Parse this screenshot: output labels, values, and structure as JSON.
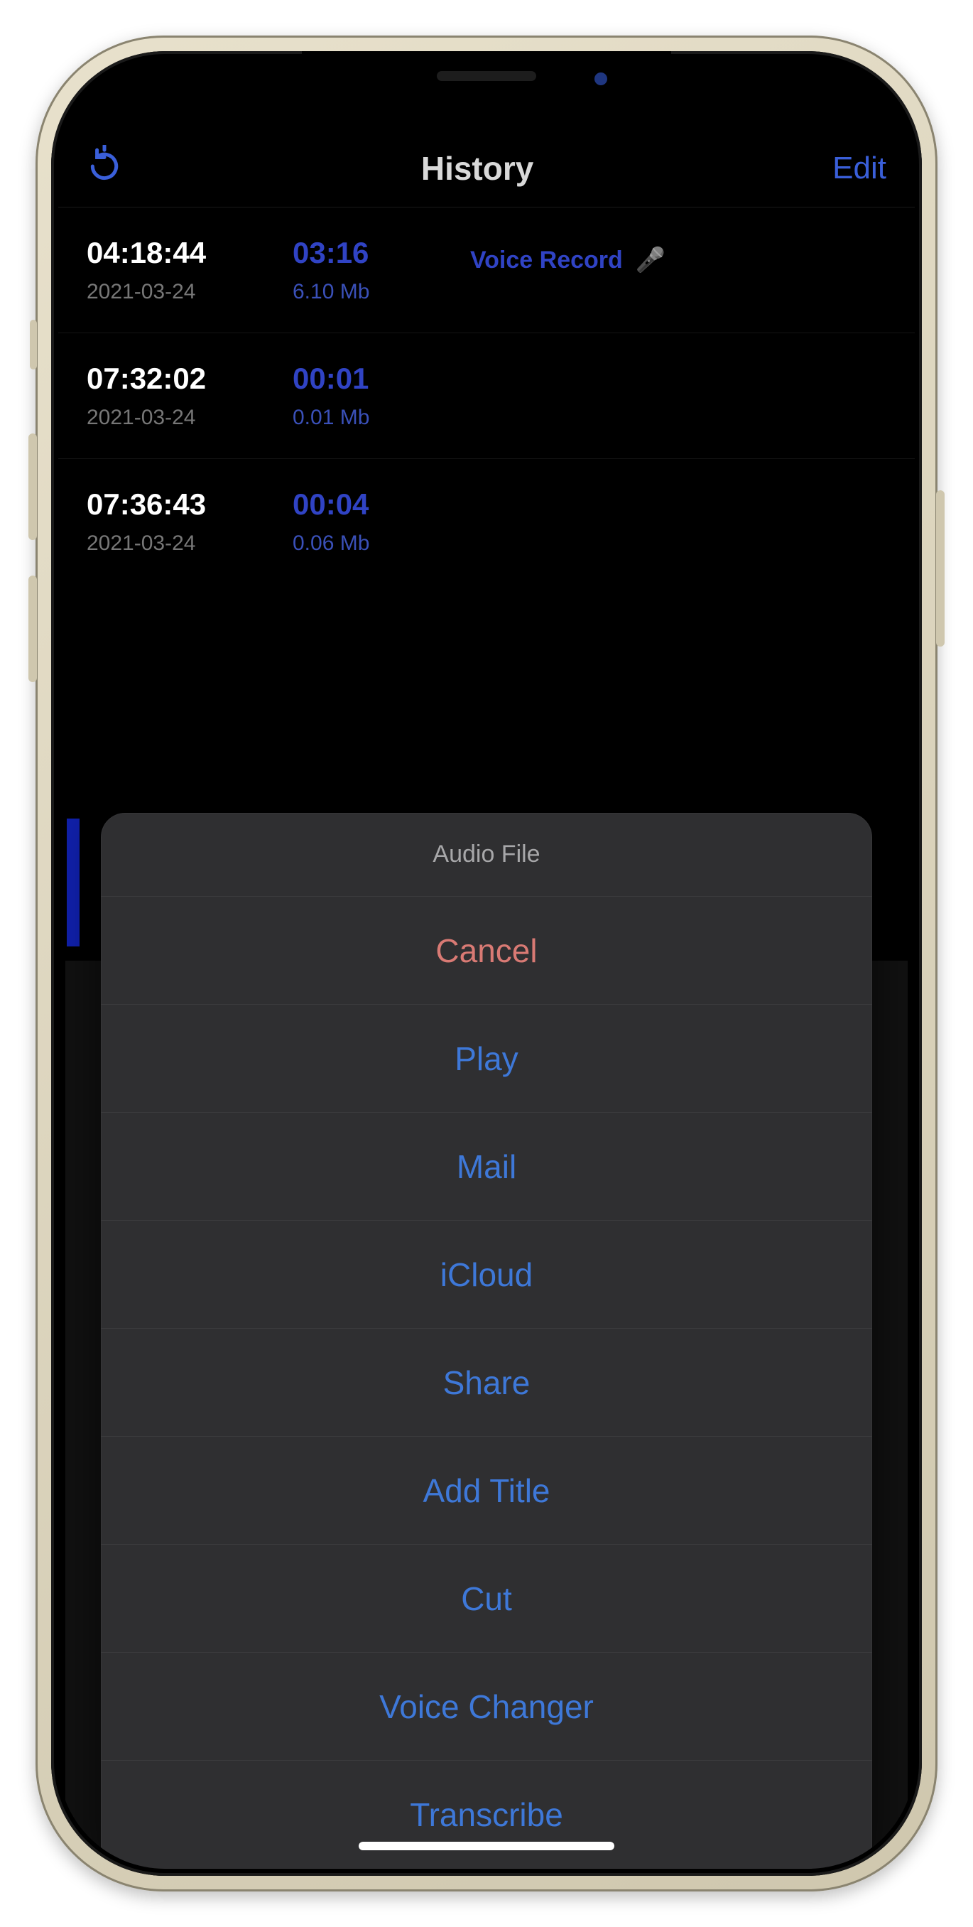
{
  "nav": {
    "title": "History",
    "edit": "Edit"
  },
  "rows": [
    {
      "time": "04:18:44",
      "date": "2021-03-24",
      "dur": "03:16",
      "size": "6.10 Mb",
      "title": "Voice  Record"
    },
    {
      "time": "07:32:02",
      "date": "2021-03-24",
      "dur": "00:01",
      "size": "0.01 Mb",
      "title": ""
    },
    {
      "time": "07:36:43",
      "date": "2021-03-24",
      "dur": "00:04",
      "size": "0.06 Mb",
      "title": ""
    }
  ],
  "sheet": {
    "header": "Audio File",
    "cancel": "Cancel",
    "items": [
      "Play",
      "Mail",
      "iCloud",
      "Share",
      "Add Title",
      "Cut",
      "Voice Changer",
      "Transcribe"
    ]
  }
}
